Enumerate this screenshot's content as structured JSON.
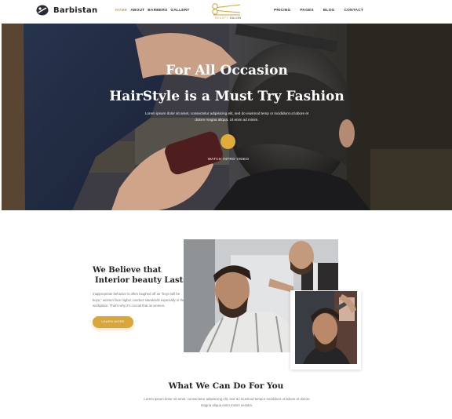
{
  "header": {
    "brand": "Barbistan",
    "nav_left": [
      "HOME",
      "ABOUT",
      "BARBERS",
      "GALLERY"
    ],
    "nav_left_active": 0,
    "center_logo": {
      "word1": "BEAUTY",
      "word2": "SALON"
    },
    "nav_right": [
      "PRICING",
      "PAGES",
      "BLOG",
      "CONTACT"
    ]
  },
  "hero": {
    "title_line1": "For All Occasion",
    "title_line2": "HairStyle is a Must Try Fashion",
    "description": "Lorem ipsum dolor sit amet, consectetur adipisicing elit, sed do eiusmod temp or incididunt ut labore et dolore magna aliqua. Ut enim ad minim.",
    "watch_label": "WATCH INTRO VIDEO"
  },
  "about": {
    "title_line1": "We Believe that",
    "title_line2": "Interior beauty Lasts Long",
    "body": "Inappropriate behavior is often laughed off as \"boys will be boys,\" women face higher conduct standards especially in the workplace. That's why it's crucial that as women.",
    "button_label": "LEARN MORE"
  },
  "services": {
    "title": "What We Can Do For You",
    "description": "Lorem ipsum dolor sit amet, consectetur adipisicing elit, sed do eiusmod tempor incididunt ut labore et dolore magna aliqua enim minim veniam."
  },
  "colors": {
    "accent": "#d9a63a",
    "dark": "#222222"
  },
  "icons": {
    "brand": "barber-pole-icon",
    "play": "play-icon"
  }
}
